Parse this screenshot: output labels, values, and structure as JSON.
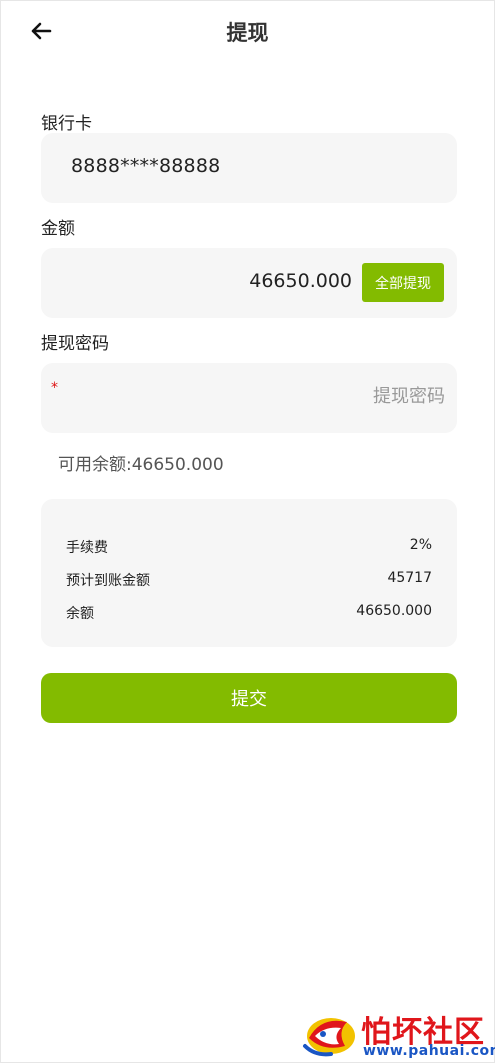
{
  "header": {
    "title": "提现",
    "back_icon": "arrow-left-icon"
  },
  "bank_card": {
    "label": "银行卡",
    "value": "8888****88888"
  },
  "amount": {
    "label": "金额",
    "value": "46650.000",
    "withdraw_all_label": "全部提现"
  },
  "password": {
    "label": "提现密码",
    "required_mark": "*",
    "placeholder": "提现密码",
    "value": ""
  },
  "balance_text": "可用余额:46650.000",
  "summary": {
    "rows": [
      {
        "key": "手续费",
        "value": "2%"
      },
      {
        "key": "预计到账金额",
        "value": "45717"
      },
      {
        "key": "余额",
        "value": "46650.000"
      }
    ]
  },
  "submit_label": "提交",
  "watermark": {
    "text": "怕坏社区",
    "url": "www.pahuai.com"
  },
  "colors": {
    "accent": "#83bb00",
    "field_bg": "#f6f6f6",
    "required": "#dd1111"
  }
}
